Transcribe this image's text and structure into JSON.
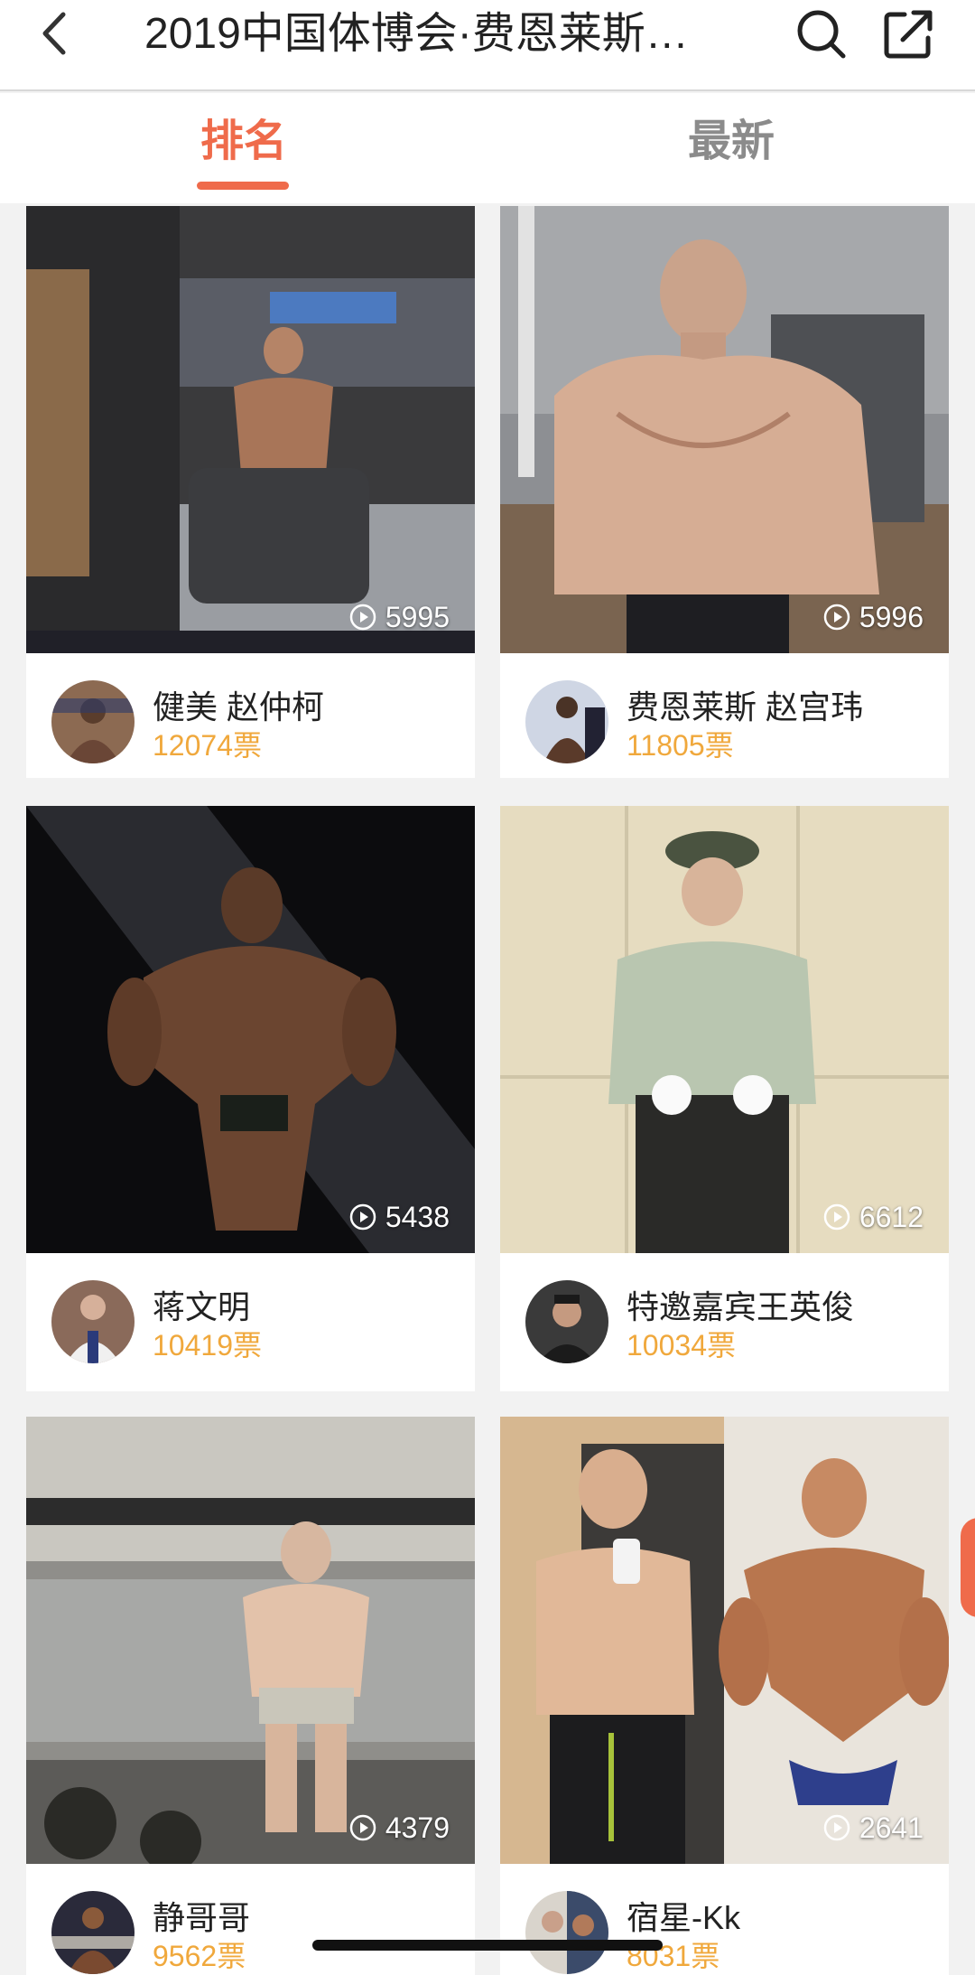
{
  "header": {
    "title": "2019中国体博会·费恩莱斯…",
    "back_icon": "chevron-left-icon",
    "search_icon": "search-icon",
    "share_icon": "share-icon"
  },
  "tabs": [
    {
      "label": "排名",
      "active": true
    },
    {
      "label": "最新",
      "active": false
    }
  ],
  "colors": {
    "accent": "#ef6b4b",
    "votes": "#f0a83c",
    "background": "#f2f2f2"
  },
  "cards": [
    {
      "views": "5995",
      "name": "健美 赵仲柯",
      "votes": "12074票"
    },
    {
      "views": "5996",
      "name": "费恩莱斯  赵宫玮",
      "votes": "11805票"
    },
    {
      "views": "5438",
      "name": "蒋文明",
      "votes": "10419票"
    },
    {
      "views": "6612",
      "name": "特邀嘉宾王英俊",
      "votes": "10034票"
    },
    {
      "views": "4379",
      "name": "静哥哥",
      "votes": "9562票"
    },
    {
      "views": "2641",
      "name": "宿星-Kk",
      "votes": "8031票"
    }
  ]
}
